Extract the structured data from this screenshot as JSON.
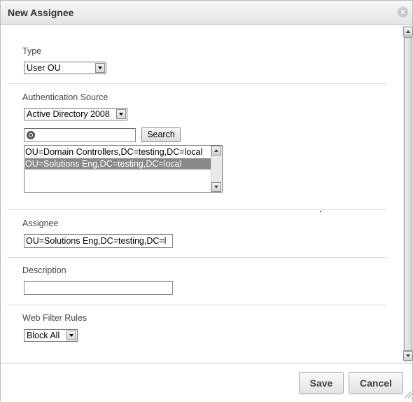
{
  "dialog": {
    "title": "New Assignee",
    "close_icon": "close-icon"
  },
  "type": {
    "label": "Type",
    "selected": "User OU"
  },
  "auth_source": {
    "label": "Authentication Source",
    "selected": "Active Directory 2008",
    "search_value": "",
    "search_button": "Search",
    "results": [
      {
        "text": "OU=Domain Controllers,DC=testing,DC=local",
        "selected": false
      },
      {
        "text": "OU=Solutions Eng,DC=testing,DC=local",
        "selected": true
      }
    ]
  },
  "assignee": {
    "label": "Assignee",
    "value": "OU=Solutions Eng,DC=testing,DC=l"
  },
  "description": {
    "label": "Description",
    "value": ""
  },
  "web_filter": {
    "label": "Web Filter Rules",
    "selected": "Block All"
  },
  "footer": {
    "save": "Save",
    "cancel": "Cancel"
  }
}
